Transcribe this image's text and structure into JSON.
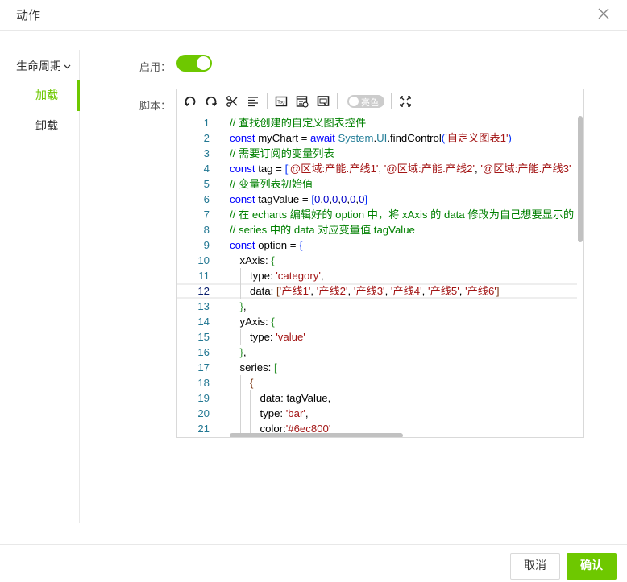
{
  "dialog": {
    "title": "动作",
    "close_icon": "close-icon"
  },
  "sidebar": {
    "group_label": "生命周期",
    "items": [
      {
        "label": "加载",
        "active": true
      },
      {
        "label": "卸载",
        "active": false
      }
    ]
  },
  "form": {
    "enable_label": "启用：",
    "enabled": true,
    "script_label": "脚本："
  },
  "toolbar": {
    "icons": [
      "undo-icon",
      "redo-icon",
      "cut-icon",
      "format-icon",
      "tag-icon",
      "info-doc-icon",
      "screen-icon",
      "theme-toggle",
      "fullscreen-icon"
    ],
    "theme_label": "亮色"
  },
  "editor": {
    "active_line": 12,
    "lines": [
      {
        "n": "1",
        "indent": 0,
        "tokens": [
          [
            "cm",
            "// 查找创建的自定义图表控件"
          ]
        ]
      },
      {
        "n": "2",
        "indent": 0,
        "tokens": [
          [
            "kw",
            "const "
          ],
          [
            "id",
            "myChart = "
          ],
          [
            "kw",
            "await "
          ],
          [
            "def",
            "System"
          ],
          [
            "id",
            "."
          ],
          [
            "def",
            "UI"
          ],
          [
            "id",
            ".findControl"
          ],
          [
            "br1",
            "("
          ],
          [
            "str",
            "'自定义图表1'"
          ],
          [
            "br1",
            ")"
          ]
        ]
      },
      {
        "n": "3",
        "indent": 0,
        "tokens": [
          [
            "cm",
            "// 需要订阅的变量列表"
          ]
        ]
      },
      {
        "n": "4",
        "indent": 0,
        "tokens": [
          [
            "kw",
            "const "
          ],
          [
            "id",
            "tag = "
          ],
          [
            "br1",
            "["
          ],
          [
            "str",
            "'@区域:产能.产线1'"
          ],
          [
            "id",
            ", "
          ],
          [
            "str",
            "'@区域:产能.产线2'"
          ],
          [
            "id",
            ", "
          ],
          [
            "str",
            "'@区域:产能.产线3'"
          ]
        ]
      },
      {
        "n": "5",
        "indent": 0,
        "tokens": [
          [
            "cm",
            "// 变量列表初始值"
          ]
        ]
      },
      {
        "n": "6",
        "indent": 0,
        "tokens": [
          [
            "kw",
            "const "
          ],
          [
            "id",
            "tagValue = "
          ],
          [
            "br1",
            "["
          ],
          [
            "num",
            "0"
          ],
          [
            "id",
            ","
          ],
          [
            "num",
            "0"
          ],
          [
            "id",
            ","
          ],
          [
            "num",
            "0"
          ],
          [
            "id",
            ","
          ],
          [
            "num",
            "0"
          ],
          [
            "id",
            ","
          ],
          [
            "num",
            "0"
          ],
          [
            "id",
            ","
          ],
          [
            "num",
            "0"
          ],
          [
            "br1",
            "]"
          ]
        ]
      },
      {
        "n": "7",
        "indent": 0,
        "tokens": [
          [
            "cm",
            "// 在 echarts 编辑好的 option 中，将 xAxis 的 data 修改为自己想要显示的"
          ]
        ]
      },
      {
        "n": "8",
        "indent": 0,
        "tokens": [
          [
            "cm",
            "// series 中的 data 对应变量值 tagValue"
          ]
        ]
      },
      {
        "n": "9",
        "indent": 0,
        "tokens": [
          [
            "kw",
            "const "
          ],
          [
            "id",
            "option = "
          ],
          [
            "br1",
            "{"
          ]
        ]
      },
      {
        "n": "10",
        "indent": 1,
        "tokens": [
          [
            "id",
            "xAxis: "
          ],
          [
            "br2",
            "{"
          ]
        ]
      },
      {
        "n": "11",
        "indent": 2,
        "tokens": [
          [
            "id",
            "type: "
          ],
          [
            "str",
            "'category'"
          ],
          [
            "id",
            ","
          ]
        ]
      },
      {
        "n": "12",
        "indent": 2,
        "tokens": [
          [
            "id",
            "data: "
          ],
          [
            "br3",
            "["
          ],
          [
            "str",
            "'产线1'"
          ],
          [
            "id",
            ", "
          ],
          [
            "str",
            "'产线2'"
          ],
          [
            "id",
            ", "
          ],
          [
            "str",
            "'产线3'"
          ],
          [
            "id",
            ", "
          ],
          [
            "str",
            "'产线4'"
          ],
          [
            "id",
            ", "
          ],
          [
            "str",
            "'产线5'"
          ],
          [
            "id",
            ", "
          ],
          [
            "str",
            "'产线6'"
          ],
          [
            "br3",
            "]"
          ]
        ]
      },
      {
        "n": "13",
        "indent": 1,
        "tokens": [
          [
            "br2",
            "}"
          ],
          [
            "id",
            ","
          ]
        ]
      },
      {
        "n": "14",
        "indent": 1,
        "tokens": [
          [
            "id",
            "yAxis: "
          ],
          [
            "br2",
            "{"
          ]
        ]
      },
      {
        "n": "15",
        "indent": 2,
        "tokens": [
          [
            "id",
            "type: "
          ],
          [
            "str",
            "'value'"
          ]
        ]
      },
      {
        "n": "16",
        "indent": 1,
        "tokens": [
          [
            "br2",
            "}"
          ],
          [
            "id",
            ","
          ]
        ]
      },
      {
        "n": "17",
        "indent": 1,
        "tokens": [
          [
            "id",
            "series: "
          ],
          [
            "br2",
            "["
          ]
        ]
      },
      {
        "n": "18",
        "indent": 2,
        "tokens": [
          [
            "br3",
            "{"
          ]
        ]
      },
      {
        "n": "19",
        "indent": 3,
        "tokens": [
          [
            "id",
            "data: tagValue,"
          ]
        ]
      },
      {
        "n": "20",
        "indent": 3,
        "tokens": [
          [
            "id",
            "type: "
          ],
          [
            "str",
            "'bar'"
          ],
          [
            "id",
            ","
          ]
        ]
      },
      {
        "n": "21",
        "indent": 3,
        "tokens": [
          [
            "id",
            "color:"
          ],
          [
            "str",
            "'#6ec800'"
          ]
        ]
      }
    ]
  },
  "footer": {
    "cancel_label": "取消",
    "ok_label": "确认"
  },
  "colors": {
    "accent": "#6ec800"
  }
}
